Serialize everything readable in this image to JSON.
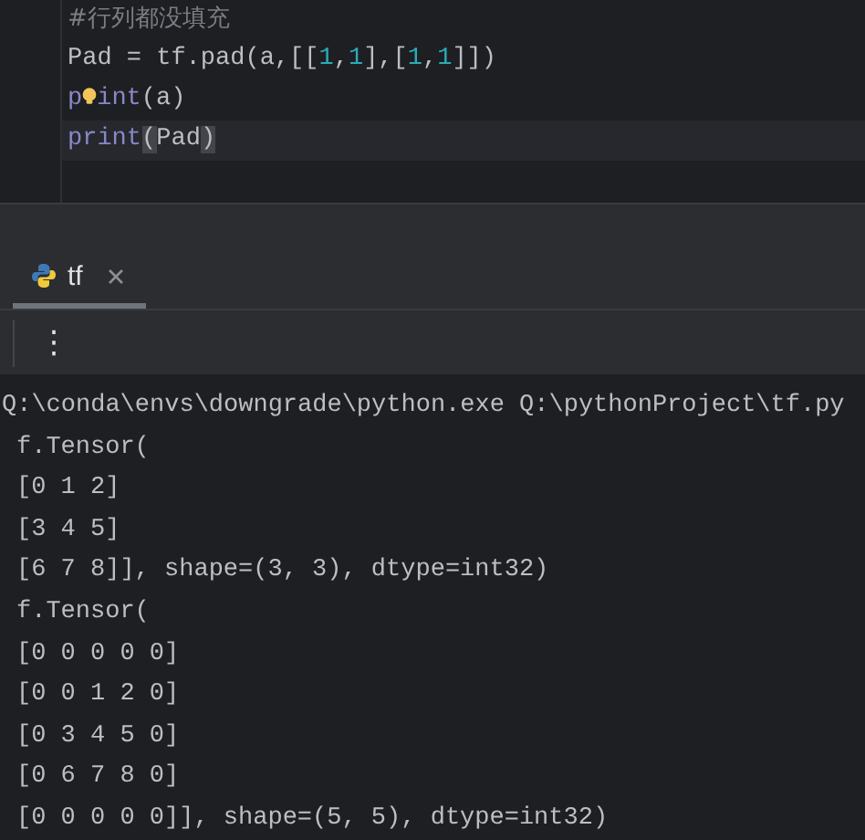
{
  "editor": {
    "lines": [
      {
        "current": false,
        "bulb": false,
        "tokens": [
          {
            "kind": "comment",
            "text": "#行列都没填充"
          }
        ]
      },
      {
        "current": false,
        "bulb": false,
        "tokens": [
          {
            "kind": "plain",
            "text": "Pad = tf.pad(a,[["
          },
          {
            "kind": "number",
            "text": "1"
          },
          {
            "kind": "plain",
            "text": ","
          },
          {
            "kind": "number",
            "text": "1"
          },
          {
            "kind": "plain",
            "text": "],["
          },
          {
            "kind": "number",
            "text": "1"
          },
          {
            "kind": "plain",
            "text": ","
          },
          {
            "kind": "number",
            "text": "1"
          },
          {
            "kind": "plain",
            "text": "]])"
          }
        ]
      },
      {
        "current": false,
        "bulb": true,
        "tokens": [
          {
            "kind": "builtin",
            "text": "p"
          },
          {
            "kind": "bulb"
          },
          {
            "kind": "builtin",
            "text": "int"
          },
          {
            "kind": "plain",
            "text": "(a)"
          }
        ]
      },
      {
        "current": true,
        "bulb": false,
        "tokens": [
          {
            "kind": "builtin",
            "text": "print"
          },
          {
            "kind": "match",
            "text": "("
          },
          {
            "kind": "plain",
            "text": "Pad"
          },
          {
            "kind": "match",
            "text": ")"
          }
        ]
      }
    ]
  },
  "run_tabs": [
    {
      "label": "tf",
      "selected": true
    }
  ],
  "toolbar": {
    "more": "⋮"
  },
  "console": {
    "lines": [
      "Q:\\conda\\envs\\downgrade\\python.exe Q:\\pythonProject\\tf.py",
      "f.Tensor(",
      "[0 1 2]",
      "[3 4 5]",
      "[6 7 8]], shape=(3, 3), dtype=int32)",
      "f.Tensor(",
      "[0 0 0 0 0]",
      "[0 0 1 2 0]",
      "[0 3 4 5 0]",
      "[0 6 7 8 0]",
      "[0 0 0 0 0]], shape=(5, 5), dtype=int32)"
    ]
  }
}
